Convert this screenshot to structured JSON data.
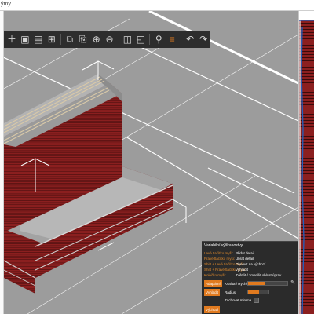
{
  "window": {
    "title": "ýmy"
  },
  "toolbar": {
    "icons": [
      "add-icon",
      "delete-icon",
      "delete-all-icon",
      "arrange-icon",
      "copy-icon",
      "paste-icon",
      "add-instance-icon",
      "remove-instance-icon",
      "split-objects-icon",
      "split-parts-icon",
      "search-icon",
      "layers-editing-icon",
      "undo-icon",
      "redo-icon"
    ],
    "glyphs": [
      "＋",
      "▣",
      "▤",
      "⊞",
      "⧉",
      "⎘",
      "⊕",
      "⊖",
      "◫",
      "◰",
      "⚲",
      "≡",
      "↶",
      "↷"
    ]
  },
  "panel": {
    "title": "Variabilní výška vrstvy",
    "shortcuts": [
      {
        "key": "Levé tlačítko myši:",
        "action": "Přidat detail"
      },
      {
        "key": "Pravé tlačítko myši:",
        "action": "Ubrat detail"
      },
      {
        "key": "Shift + Levé tlačítko myši:",
        "action": "Obnovit na výchozí"
      },
      {
        "key": "Shift + Pravé tlačítko myši:",
        "action": "Vyhladit"
      },
      {
        "key": "Kolečko myši:",
        "action": "Zvětšit / zmenšit oblast úprav"
      }
    ],
    "adaptive_button": "Adaptivní",
    "quality_label": "Kvalita / Rychlost",
    "smooth_button": "Vyhladit",
    "radius_label": "Radius",
    "keep_min_label": "Zachovat minima",
    "reset_button": "Výchozí"
  },
  "colors": {
    "model_side": "#8b1f1f",
    "model_layer_line": "#3a0b0b",
    "model_top": "#a9a9a9",
    "bed": "#9c9c9c",
    "accent": "#e07a1f",
    "panel_bg": "#2b2b2b"
  }
}
